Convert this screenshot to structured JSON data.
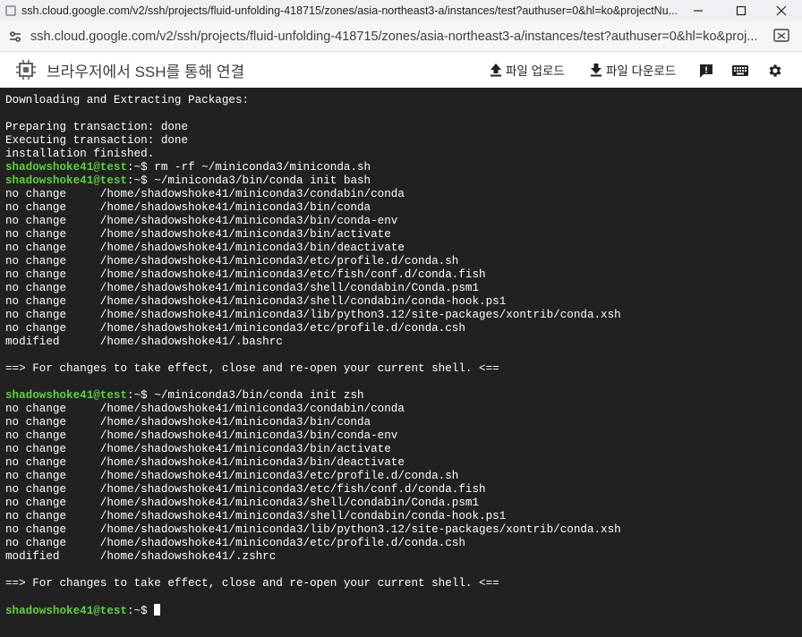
{
  "window": {
    "title": "ssh.cloud.google.com/v2/ssh/projects/fluid-unfolding-418715/zones/asia-northeast3-a/instances/test?authuser=0&hl=ko&projectNu..."
  },
  "address_bar": {
    "url": "ssh.cloud.google.com/v2/ssh/projects/fluid-unfolding-418715/zones/asia-northeast3-a/instances/test?authuser=0&hl=ko&proj..."
  },
  "toolbar": {
    "title": "브라우저에서 SSH를 통해 연결",
    "upload_label": "파일 업로드",
    "download_label": "파일 다운로드"
  },
  "terminal": {
    "prompt_user": "shadowshoke41@test",
    "lines": [
      {
        "text": "Downloading and Extracting Packages:"
      },
      {
        "text": ""
      },
      {
        "text": "Preparing transaction: done"
      },
      {
        "text": "Executing transaction: done"
      },
      {
        "text": "installation finished."
      },
      {
        "prompt": true,
        "text": ":~$ rm -rf ~/miniconda3/miniconda.sh"
      },
      {
        "prompt": true,
        "text": ":~$ ~/miniconda3/bin/conda init bash"
      },
      {
        "text": "no change     /home/shadowshoke41/miniconda3/condabin/conda"
      },
      {
        "text": "no change     /home/shadowshoke41/miniconda3/bin/conda"
      },
      {
        "text": "no change     /home/shadowshoke41/miniconda3/bin/conda-env"
      },
      {
        "text": "no change     /home/shadowshoke41/miniconda3/bin/activate"
      },
      {
        "text": "no change     /home/shadowshoke41/miniconda3/bin/deactivate"
      },
      {
        "text": "no change     /home/shadowshoke41/miniconda3/etc/profile.d/conda.sh"
      },
      {
        "text": "no change     /home/shadowshoke41/miniconda3/etc/fish/conf.d/conda.fish"
      },
      {
        "text": "no change     /home/shadowshoke41/miniconda3/shell/condabin/Conda.psm1"
      },
      {
        "text": "no change     /home/shadowshoke41/miniconda3/shell/condabin/conda-hook.ps1"
      },
      {
        "text": "no change     /home/shadowshoke41/miniconda3/lib/python3.12/site-packages/xontrib/conda.xsh"
      },
      {
        "text": "no change     /home/shadowshoke41/miniconda3/etc/profile.d/conda.csh"
      },
      {
        "text": "modified      /home/shadowshoke41/.bashrc"
      },
      {
        "text": ""
      },
      {
        "text": "==> For changes to take effect, close and re-open your current shell. <=="
      },
      {
        "text": ""
      },
      {
        "prompt": true,
        "text": ":~$ ~/miniconda3/bin/conda init zsh"
      },
      {
        "text": "no change     /home/shadowshoke41/miniconda3/condabin/conda"
      },
      {
        "text": "no change     /home/shadowshoke41/miniconda3/bin/conda"
      },
      {
        "text": "no change     /home/shadowshoke41/miniconda3/bin/conda-env"
      },
      {
        "text": "no change     /home/shadowshoke41/miniconda3/bin/activate"
      },
      {
        "text": "no change     /home/shadowshoke41/miniconda3/bin/deactivate"
      },
      {
        "text": "no change     /home/shadowshoke41/miniconda3/etc/profile.d/conda.sh"
      },
      {
        "text": "no change     /home/shadowshoke41/miniconda3/etc/fish/conf.d/conda.fish"
      },
      {
        "text": "no change     /home/shadowshoke41/miniconda3/shell/condabin/Conda.psm1"
      },
      {
        "text": "no change     /home/shadowshoke41/miniconda3/shell/condabin/conda-hook.ps1"
      },
      {
        "text": "no change     /home/shadowshoke41/miniconda3/lib/python3.12/site-packages/xontrib/conda.xsh"
      },
      {
        "text": "no change     /home/shadowshoke41/miniconda3/etc/profile.d/conda.csh"
      },
      {
        "text": "modified      /home/shadowshoke41/.zshrc"
      },
      {
        "text": ""
      },
      {
        "text": "==> For changes to take effect, close and re-open your current shell. <=="
      },
      {
        "text": ""
      },
      {
        "prompt": true,
        "text": ":~$ ",
        "cursor": true
      }
    ]
  },
  "colors": {
    "terminal_bg": "#212121",
    "prompt_user": "#5cd23c",
    "terminal_text": "#ffffff"
  },
  "icons": [
    "favicon-icon",
    "site-info-icon",
    "cast-icon",
    "chip-icon",
    "upload-icon",
    "download-icon",
    "feedback-icon",
    "keyboard-icon",
    "gear-icon",
    "minimize-icon",
    "maximize-icon",
    "close-icon"
  ]
}
